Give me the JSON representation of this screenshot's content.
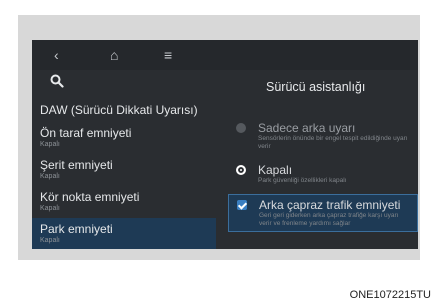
{
  "nav": {
    "back_icon": "back-arrow-icon",
    "home_icon": "home-icon",
    "menu_icon": "menu-icon",
    "back_glyph": "‹",
    "home_glyph": "⌂",
    "menu_glyph": "≡"
  },
  "search": {
    "icon": "search-icon",
    "glyph": "⚲"
  },
  "panel": {
    "title": "Sürücü asistanlığı"
  },
  "sidebar": {
    "items": [
      {
        "label": "DAW (Sürücü Dikkati Uyarısı)",
        "sub": ""
      },
      {
        "label": "Ön taraf emniyeti",
        "sub": "Kapalı"
      },
      {
        "label": "Şerit emniyeti",
        "sub": "Kapalı"
      },
      {
        "label": "Kör nokta emniyeti",
        "sub": "Kapalı"
      },
      {
        "label": "Park emniyeti",
        "sub": "Kapalı"
      }
    ]
  },
  "options": [
    {
      "label": "Sadece arka uyarı",
      "sub": "Sensörlerin önünde bir engel tespit edildiğinde uyarı verir"
    },
    {
      "label": "Kapalı",
      "sub": "Park güvenliği özellikleri kapalı"
    },
    {
      "label": "Arka çapraz trafik emniyeti",
      "sub": "Geri geri giderken arka çapraz trafiğe karşı uyarı verir ve frenleme yardımı sağlar"
    }
  ],
  "caption": "ONE1072215TU",
  "colors": {
    "screen_bg": "#2a2d31",
    "highlight": "#1e3a55",
    "accent": "#3a7fc2"
  }
}
